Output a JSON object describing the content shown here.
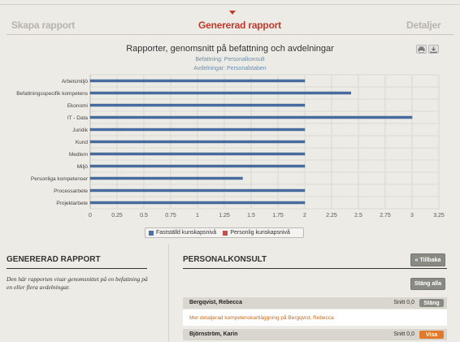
{
  "wizard": {
    "steps": [
      "Skapa rapport",
      "Genererad rapport",
      "Detaljer"
    ],
    "active": 1
  },
  "chart_header": {
    "title": "Rapporter, genomsnitt på befattning och avdelningar",
    "subtitle1": "Befattning: Personalkonsult",
    "subtitle2": "Avdelningar: Personalstaben"
  },
  "export_icons": [
    "print-icon",
    "download-icon"
  ],
  "chart_data": {
    "type": "bar",
    "orientation": "horizontal",
    "categories": [
      "Arbetsmiljö",
      "Befattningsspecifik kompetens",
      "Ekonomi",
      "IT - Data",
      "Juridik",
      "Kund",
      "Medlem",
      "Miljö",
      "Personliga kompetenser",
      "Processarbete",
      "Projektarbete"
    ],
    "series": [
      {
        "name": "Fastställd kunskapsnivå",
        "color": "#4a6fa5",
        "values": [
          2,
          2.43,
          2,
          3,
          2,
          2,
          2,
          2,
          1.42,
          2,
          2
        ]
      },
      {
        "name": "Personlig kunskapsnivå",
        "color": "#c0504d",
        "values": [
          0,
          0,
          0,
          0,
          0,
          0,
          0,
          0,
          0,
          0,
          0
        ]
      }
    ],
    "xlim": [
      0,
      3.25
    ],
    "xticks": [
      "0",
      "0.25",
      "0.5",
      "0.75",
      "1",
      "1.25",
      "1.5",
      "1.75",
      "2",
      "2.25",
      "2.5",
      "2.75",
      "3",
      "3.25"
    ],
    "grid": true,
    "legend_position": "bottom"
  },
  "left_panel": {
    "heading": "GENERERAD RAPPORT",
    "description": "Den här rapporten visar genomsnittet på en befattning på en eller flera avdelningar."
  },
  "right_panel": {
    "heading": "PERSONALKONSULT",
    "back_label": "« Tillbaka",
    "close_all_label": "Stäng alla",
    "persons": [
      {
        "name": "Bergqvist, Rebecca",
        "avg": "Snitt 0,0",
        "button": "Stäng",
        "button_color": "#8a8a85",
        "detail_link": "Mer detaljerad kompetenskartläggning på Bergqvist, Rebecca"
      },
      {
        "name": "Björnström, Karin",
        "avg": "Snitt 0,0",
        "button": "Visa",
        "button_color": "#e07b2e"
      }
    ]
  }
}
